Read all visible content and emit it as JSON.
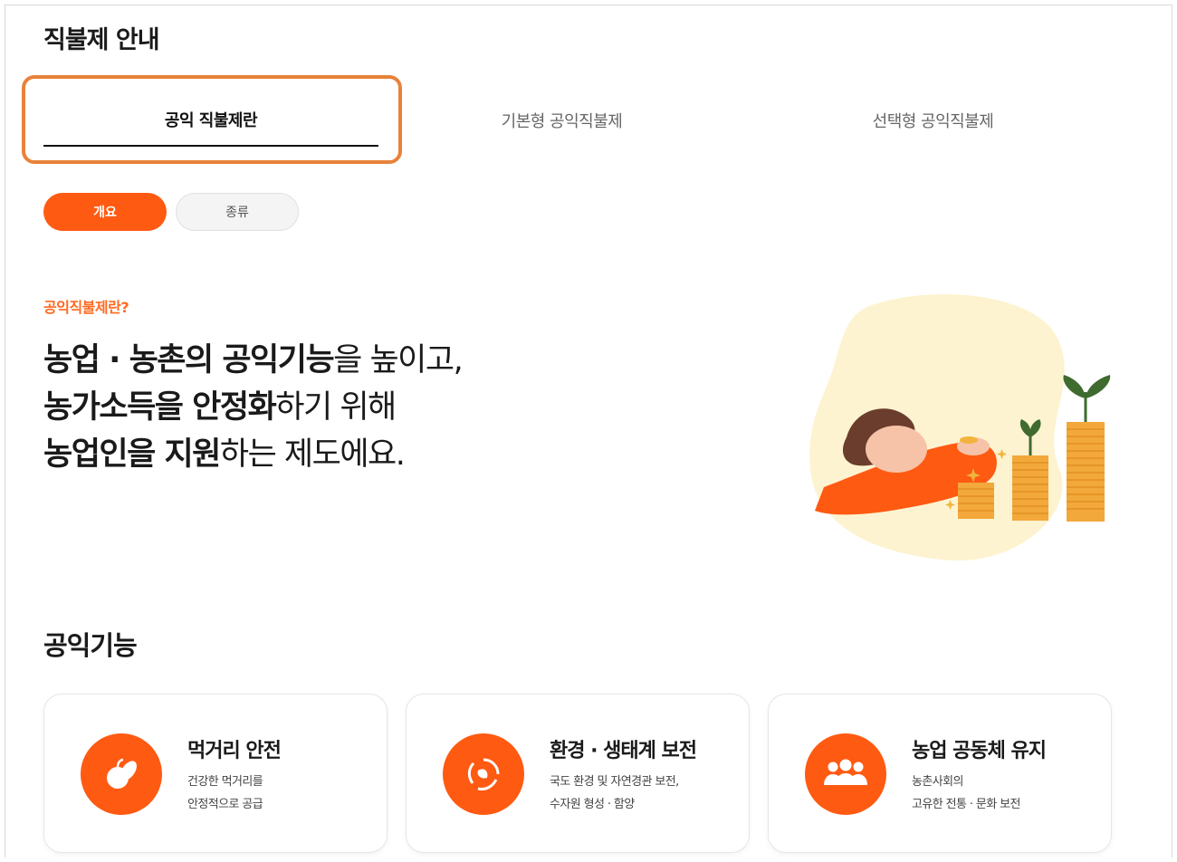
{
  "page": {
    "title": "직불제 안내"
  },
  "tabs": [
    {
      "label": "공익 직불제란",
      "active": true
    },
    {
      "label": "기본형 공익직불제",
      "active": false
    },
    {
      "label": "선택형 공익직불제",
      "active": false
    }
  ],
  "subtabs": [
    {
      "label": "개요",
      "active": true
    },
    {
      "label": "종류",
      "active": false
    }
  ],
  "intro": {
    "kicker": "공익직불제란?",
    "line1_bold": "농업 · 농촌의 공익기능",
    "line1_rest": "을 높이고,",
    "line2_bold": "농가소득을 안정화",
    "line2_rest": "하기 위해",
    "line3_bold": "농업인을 지원",
    "line3_rest": "하는 제도에요."
  },
  "section": {
    "title": "공익기능"
  },
  "cards": [
    {
      "title": "먹거리 안전",
      "desc1": "건강한 먹거리를",
      "desc2": "안정적으로 공급",
      "icon": "fruit-icon"
    },
    {
      "title": "환경 · 생태계 보전",
      "desc1": "국도 환경 및 자연경관 보전,",
      "desc2": "수자원 형성 · 함양",
      "icon": "eco-cycle-icon"
    },
    {
      "title": "농업 공동체 유지",
      "desc1": "농촌사회의",
      "desc2": "고유한 전통 · 문화 보전",
      "icon": "people-icon"
    }
  ],
  "colors": {
    "accent": "#ff5a12",
    "kicker": "#ff6a21",
    "highlight_border": "#e8823a",
    "illustration_bg": "#fdf3d0"
  }
}
